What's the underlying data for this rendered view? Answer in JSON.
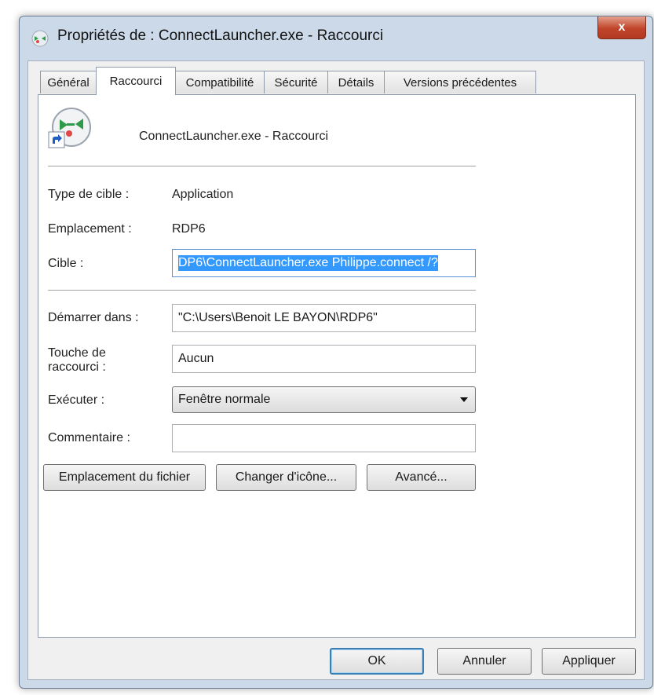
{
  "window": {
    "title": "Propriétés de : ConnectLauncher.exe - Raccourci",
    "close_label": "x"
  },
  "tabs": [
    {
      "label": "Général"
    },
    {
      "label": "Raccourci",
      "active": true
    },
    {
      "label": "Compatibilité"
    },
    {
      "label": "Sécurité"
    },
    {
      "label": "Détails"
    },
    {
      "label": "Versions précédentes"
    }
  ],
  "shortcut": {
    "name": "ConnectLauncher.exe - Raccourci",
    "type_label": "Type de cible :",
    "type_value": "Application",
    "location_label": "Emplacement :",
    "location_value": "RDP6",
    "target_label": "Cible :",
    "target_value": "DP6\\ConnectLauncher.exe Philippe.connect /?",
    "start_in_label": "Démarrer dans :",
    "start_in_value": "\"C:\\Users\\Benoit LE BAYON\\RDP6\"",
    "hotkey_label": "Touche de raccourci :",
    "hotkey_value": "Aucun",
    "run_label": "Exécuter :",
    "run_value": "Fenêtre normale",
    "comment_label": "Commentaire :",
    "comment_value": ""
  },
  "buttons": {
    "open_location": "Emplacement du fichier",
    "change_icon": "Changer d'icône...",
    "advanced": "Avancé..."
  },
  "footer": {
    "ok": "OK",
    "cancel": "Annuler",
    "apply": "Appliquer"
  },
  "icons": {
    "title": "shortcut-app-icon",
    "shortcut": "connect-launcher-icon",
    "overlay": "shortcut-arrow-icon"
  },
  "colors": {
    "selection": "#3399ff",
    "close_button": "#c0442a",
    "window_frame": "#ccd9e8"
  }
}
